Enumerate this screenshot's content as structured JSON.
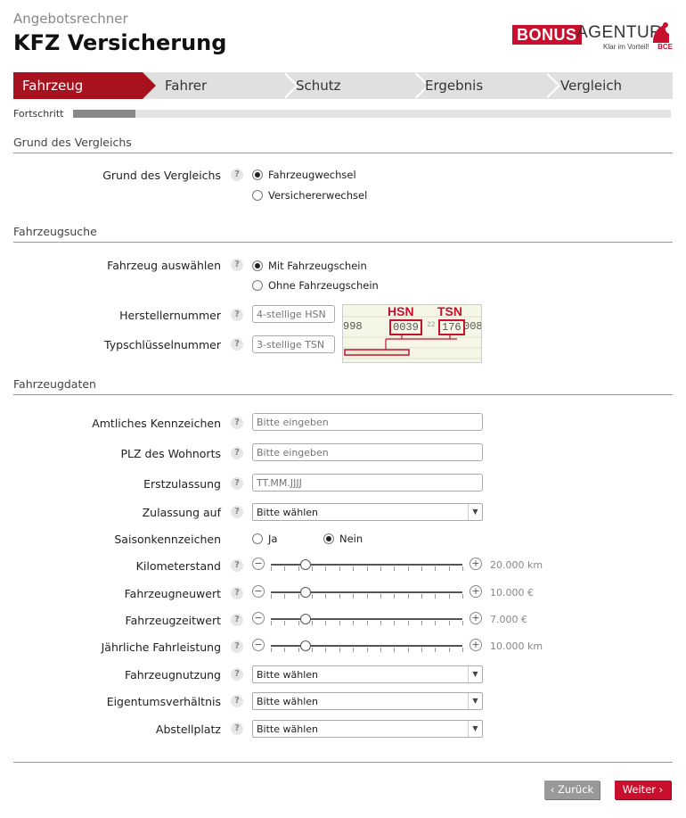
{
  "header": {
    "subtitle": "Angebotsrechner",
    "title": "KFZ Versicherung",
    "logo": {
      "bonus": "BONUS",
      "agentur": "AGENTUR",
      "tagline": "Klar im Vorteil!",
      "mark": "BCE"
    }
  },
  "steps": [
    {
      "label": "Fahrzeug",
      "active": true
    },
    {
      "label": "Fahrer",
      "active": false
    },
    {
      "label": "Schutz",
      "active": false
    },
    {
      "label": "Ergebnis",
      "active": false
    },
    {
      "label": "Vergleich",
      "active": false
    }
  ],
  "progress": {
    "label": "Fortschritt",
    "value_fraction": 0.105
  },
  "sections": {
    "grund": "Grund des Vergleichs",
    "suche": "Fahrzeugsuche",
    "daten": "Fahrzeugdaten"
  },
  "grund": {
    "label": "Grund des Vergleichs",
    "options": [
      "Fahrzeugwechsel",
      "Versichererwechsel"
    ],
    "selected": 0
  },
  "suche": {
    "label": "Fahrzeug auswählen",
    "options": [
      "Mit Fahrzeugschein",
      "Ohne Fahrzeugschein"
    ],
    "selected": 0,
    "hsn": {
      "label": "Herstellernummer",
      "placeholder": "4-stellige HSN"
    },
    "tsn": {
      "label": "Typschlüsselnummer",
      "placeholder": "3-stellige TSN"
    },
    "image": {
      "hsn_label": "HSN",
      "tsn_label": "TSN",
      "hsn_value": "0039",
      "tsn_value": "176",
      "left_fragment": "998",
      "right_fragment": "008",
      "mid_fragment": "22"
    }
  },
  "daten": {
    "kennzeichen": {
      "label": "Amtliches Kennzeichen",
      "placeholder": "Bitte eingeben"
    },
    "plz": {
      "label": "PLZ des Wohnorts",
      "placeholder": "Bitte eingeben"
    },
    "erstzulassung": {
      "label": "Erstzulassung",
      "placeholder": "TT.MM.JJJJ"
    },
    "zulassung": {
      "label": "Zulassung auf",
      "value": "Bitte wählen"
    },
    "saison": {
      "label": "Saisonkennzeichen",
      "options": [
        "Ja",
        "Nein"
      ],
      "selected": 1
    },
    "sliders": [
      {
        "label": "Kilometerstand",
        "value": "20.000 km",
        "position": 0.18
      },
      {
        "label": "Fahrzeugneuwert",
        "value": "10.000 €",
        "position": 0.18
      },
      {
        "label": "Fahrzeugzeitwert",
        "value": "7.000 €",
        "position": 0.18
      },
      {
        "label": "Jährliche Fahrleistung",
        "value": "10.000 km",
        "position": 0.18
      }
    ],
    "nutzung": {
      "label": "Fahrzeugnutzung",
      "value": "Bitte wählen"
    },
    "eigentum": {
      "label": "Eigentumsverhältnis",
      "value": "Bitte wählen"
    },
    "abstellplatz": {
      "label": "Abstellplatz",
      "value": "Bitte wählen"
    }
  },
  "help_glyph": "?",
  "buttons": {
    "back": "‹ Zurück",
    "next": "Weiter ›"
  },
  "colors": {
    "accent": "#a8111e",
    "brand": "#c8102e"
  }
}
